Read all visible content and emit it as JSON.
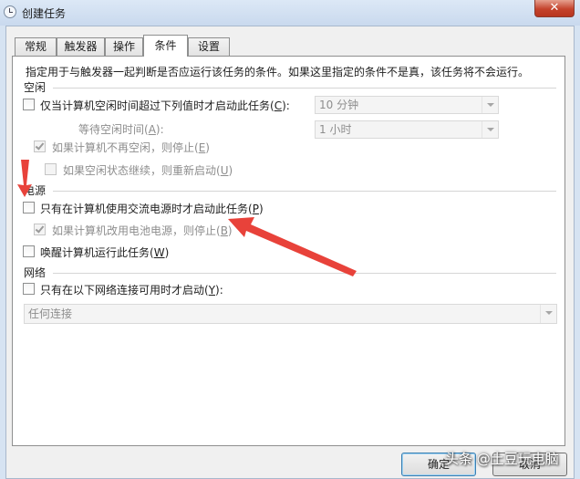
{
  "window": {
    "title": "创建任务",
    "close_glyph": "✕"
  },
  "tabs": [
    {
      "label": "常规"
    },
    {
      "label": "触发器"
    },
    {
      "label": "操作"
    },
    {
      "label": "条件",
      "active": true
    },
    {
      "label": "设置"
    }
  ],
  "description": "指定用于与触发器一起判断是否应运行该任务的条件。如果这里指定的条件不是真，该任务将不会运行。",
  "idle": {
    "section_label": "空闲",
    "start_only_idle": {
      "label": "仅当计算机空闲时间超过下列值时才启动此任务(",
      "key": "C",
      "suffix": "):",
      "checked": false
    },
    "idle_duration_value": "10 分钟",
    "wait_label": "等待空闲时间(",
    "wait_key": "A",
    "wait_suffix": "):",
    "wait_value": "1 小时",
    "stop_if_not_idle": {
      "label": "如果计算机不再空闲，则停止(",
      "key": "E",
      "suffix": ")",
      "checked": true
    },
    "restart_if_idle": {
      "label": "如果空闲状态继续，则重新启动(",
      "key": "U",
      "suffix": ")",
      "checked": false
    }
  },
  "power": {
    "section_label": "电源",
    "ac_only": {
      "label": "只有在计算机使用交流电源时才启动此任务(",
      "key": "P",
      "suffix": ")",
      "checked": false
    },
    "stop_on_battery": {
      "label": "如果计算机改用电池电源，则停止(",
      "key": "B",
      "suffix": ")",
      "checked": true
    },
    "wake_to_run": {
      "label": "唤醒计算机运行此任务(",
      "key": "W",
      "suffix": ")",
      "checked": false
    }
  },
  "network": {
    "section_label": "网络",
    "network_only": {
      "label": "只有在以下网络连接可用时才启动(",
      "key": "Y",
      "suffix": "):",
      "checked": false
    },
    "connection_value": "任何连接"
  },
  "buttons": {
    "ok": "确定",
    "cancel": "取消"
  },
  "watermark": "头条 @土豆玩电脑",
  "colors": {
    "annotation_arrow": "#e8423a",
    "panel_bg": "#ffffff",
    "title_bg": "#d6e3f2"
  }
}
